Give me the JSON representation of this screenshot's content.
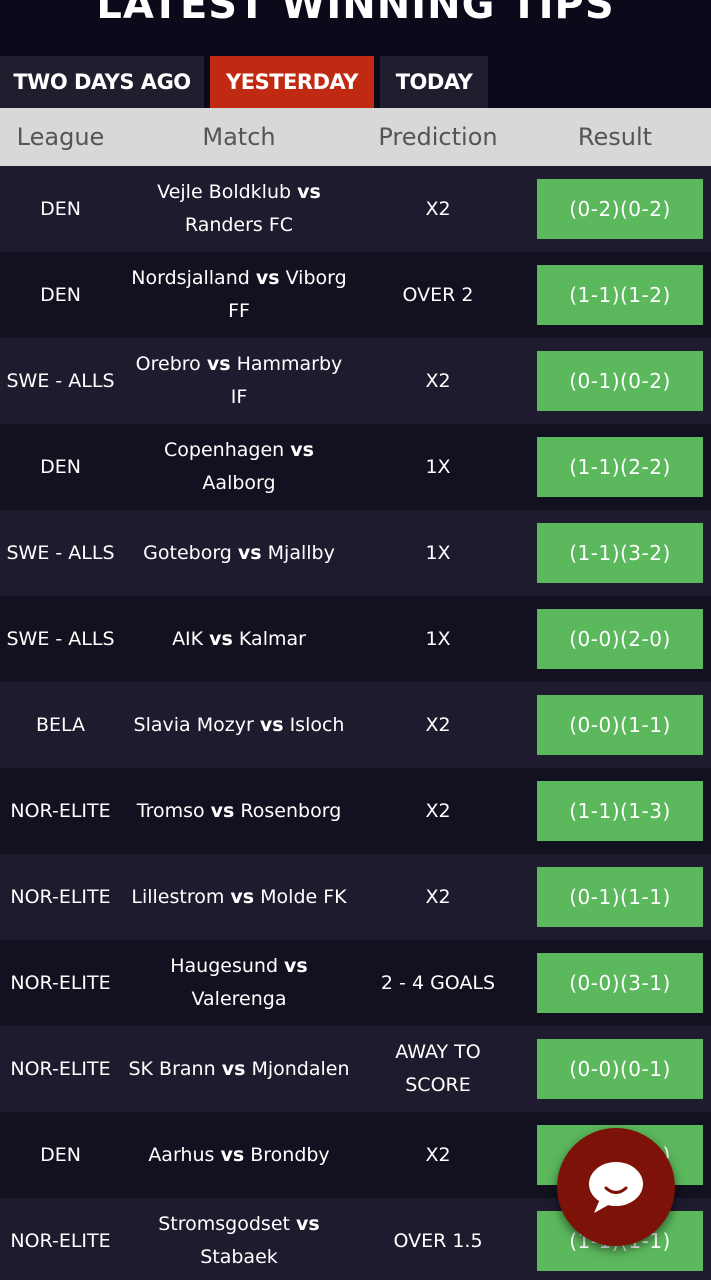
{
  "page_title": "LATEST WINNING TIPS",
  "tabs": [
    {
      "label": "TWO DAYS AGO",
      "active": false
    },
    {
      "label": "YESTERDAY",
      "active": true
    },
    {
      "label": "TODAY",
      "active": false
    }
  ],
  "table": {
    "headers": [
      "League",
      "Match",
      "Prediction",
      "Result"
    ],
    "vs_label": "vs",
    "rows": [
      {
        "league": "DEN",
        "home": "Vejle Boldklub",
        "away": "Randers FC",
        "prediction": "X2",
        "result": "(0-2)(0-2)"
      },
      {
        "league": "DEN",
        "home": "Nordsjalland",
        "away": "Viborg FF",
        "prediction": "OVER 2",
        "result": "(1-1)(1-2)"
      },
      {
        "league": "SWE - ALLS",
        "home": "Orebro",
        "away": "Hammarby IF",
        "prediction": "X2",
        "result": "(0-1)(0-2)"
      },
      {
        "league": "DEN",
        "home": "Copenhagen",
        "away": "Aalborg",
        "prediction": "1X",
        "result": "(1-1)(2-2)"
      },
      {
        "league": "SWE - ALLS",
        "home": "Goteborg",
        "away": "Mjallby",
        "prediction": "1X",
        "result": "(1-1)(3-2)"
      },
      {
        "league": "SWE - ALLS",
        "home": "AIK",
        "away": "Kalmar",
        "prediction": "1X",
        "result": "(0-0)(2-0)"
      },
      {
        "league": "BELA",
        "home": "Slavia Mozyr",
        "away": "Isloch",
        "prediction": "X2",
        "result": "(0-0)(1-1)"
      },
      {
        "league": "NOR-ELITE",
        "home": "Tromso",
        "away": "Rosenborg",
        "prediction": "X2",
        "result": "(1-1)(1-3)"
      },
      {
        "league": "NOR-ELITE",
        "home": "Lillestrom",
        "away": "Molde FK",
        "prediction": "X2",
        "result": "(0-1)(1-1)"
      },
      {
        "league": "NOR-ELITE",
        "home": "Haugesund",
        "away": "Valerenga",
        "prediction": "2 - 4 GOALS",
        "result": "(0-0)(3-1)"
      },
      {
        "league": "NOR-ELITE",
        "home": "SK Brann",
        "away": "Mjondalen",
        "prediction": "AWAY TO SCORE",
        "result": "(0-0)(0-1)"
      },
      {
        "league": "DEN",
        "home": "Aarhus",
        "away": "Brondby",
        "prediction": "X2",
        "result": "(1-1)(1-1)"
      },
      {
        "league": "NOR-ELITE",
        "home": "Stromsgodset",
        "away": "Stabaek",
        "prediction": "OVER 1.5",
        "result": "(1-1)(1-1)"
      }
    ]
  },
  "colors": {
    "background": "#0e0e1c",
    "row_odd": "#1d1b2d",
    "row_even": "#11111f",
    "tab_active": "#c12a12",
    "tab_inactive": "#1e1e2e",
    "header_bg": "#d8d8d8",
    "result_green": "#5cb85c",
    "chat_button": "#7c1208"
  },
  "icons": {
    "chat": "chat-bubble-icon"
  }
}
